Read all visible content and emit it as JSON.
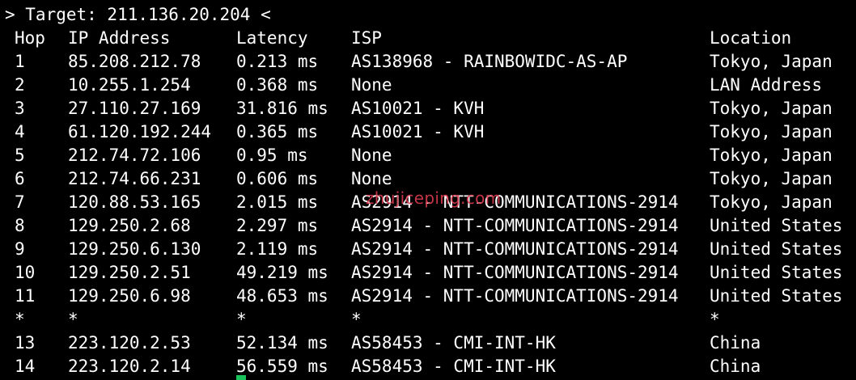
{
  "terminal": {
    "target_line": "> Target: 211.136.20.204 <",
    "headers": {
      "hop": "Hop",
      "ip": "IP Address",
      "latency": "Latency",
      "isp": "ISP",
      "location": "Location"
    },
    "rows": [
      {
        "hop": "1",
        "ip": "85.208.212.78",
        "latency": "0.213 ms",
        "isp": "AS138968 - RAINBOWIDC-AS-AP",
        "location": "Tokyo, Japan"
      },
      {
        "hop": "2",
        "ip": "10.255.1.254",
        "latency": "0.368 ms",
        "isp": "None",
        "location": "LAN Address"
      },
      {
        "hop": "3",
        "ip": "27.110.27.169",
        "latency": "31.816 ms",
        "isp": "AS10021 - KVH",
        "location": "Tokyo, Japan"
      },
      {
        "hop": "4",
        "ip": "61.120.192.244",
        "latency": "0.365 ms",
        "isp": "AS10021 - KVH",
        "location": "Tokyo, Japan"
      },
      {
        "hop": "5",
        "ip": "212.74.72.106",
        "latency": "0.95 ms",
        "isp": "None",
        "location": "Tokyo, Japan"
      },
      {
        "hop": "6",
        "ip": "212.74.66.231",
        "latency": "0.606 ms",
        "isp": "None",
        "location": "Tokyo, Japan"
      },
      {
        "hop": "7",
        "ip": "120.88.53.165",
        "latency": "2.015 ms",
        "isp": "AS2914 - NTT-COMMUNICATIONS-2914",
        "location": "Tokyo, Japan"
      },
      {
        "hop": "8",
        "ip": "129.250.2.68",
        "latency": "2.297 ms",
        "isp": "AS2914 - NTT-COMMUNICATIONS-2914",
        "location": "United States"
      },
      {
        "hop": "9",
        "ip": "129.250.6.130",
        "latency": "2.119 ms",
        "isp": "AS2914 - NTT-COMMUNICATIONS-2914",
        "location": "United States"
      },
      {
        "hop": "10",
        "ip": "129.250.2.51",
        "latency": "49.219 ms",
        "isp": "AS2914 - NTT-COMMUNICATIONS-2914",
        "location": "United States"
      },
      {
        "hop": "11",
        "ip": "129.250.6.98",
        "latency": "48.653 ms",
        "isp": "AS2914 - NTT-COMMUNICATIONS-2914",
        "location": "United States"
      },
      {
        "hop": "*",
        "ip": "*",
        "latency": "*",
        "isp": "*",
        "location": "*"
      },
      {
        "hop": "13",
        "ip": "223.120.2.53",
        "latency": "52.134 ms",
        "isp": "AS58453 - CMI-INT-HK",
        "location": "China"
      },
      {
        "hop": "14",
        "ip": "223.120.2.14",
        "latency": "56.559 ms",
        "isp": "AS58453 - CMI-INT-HK",
        "location": "China"
      }
    ],
    "watermark": "zhujiceping.com",
    "colors": {
      "background": "#000000",
      "text": "#ffffff",
      "watermark": "#d93a4f",
      "cursor": "#19c25a"
    }
  }
}
